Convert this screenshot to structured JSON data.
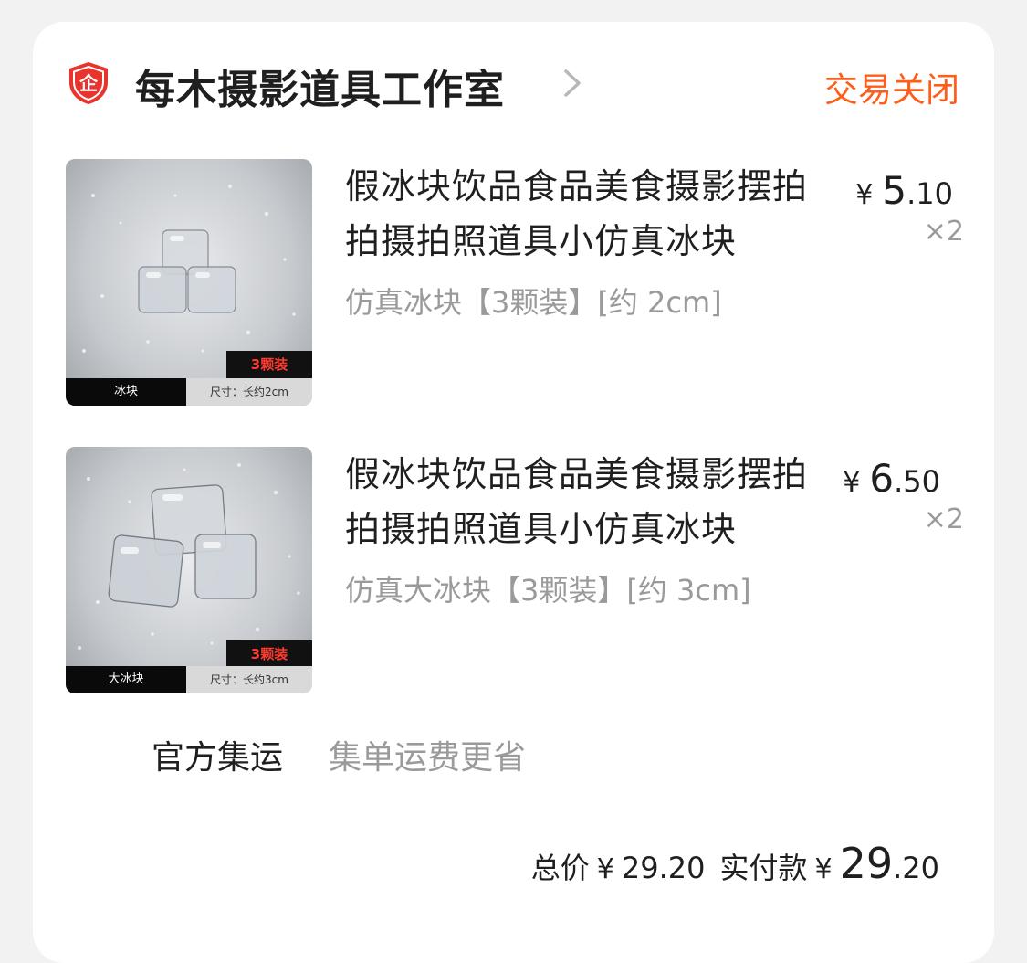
{
  "shop": {
    "name": "每木摄影道具工作室",
    "badge_text": "企",
    "status": "交易关闭"
  },
  "items": [
    {
      "title": "假冰块饮品食品美食摄影摆拍拍摄拍照道具小仿真冰块",
      "spec": "仿真冰块【3颗装】[约 2cm]",
      "price_symbol": "¥",
      "price_int": "5",
      "price_dec": ".10",
      "qty": "×2",
      "thumb_tag": "3颗装",
      "thumb_label_left": "冰块",
      "thumb_label_right": "尺寸：长约2cm"
    },
    {
      "title": "假冰块饮品食品美食摄影摆拍拍摄拍照道具小仿真冰块",
      "spec": "仿真大冰块【3颗装】[约 3cm]",
      "price_symbol": "¥",
      "price_int": "6",
      "price_dec": ".50",
      "qty": "×2",
      "thumb_tag": "3颗装",
      "thumb_label_left": "大冰块",
      "thumb_label_right": "尺寸：长约3cm"
    }
  ],
  "shipping": {
    "title": "官方集运",
    "desc": "集单运费更省"
  },
  "totals": {
    "total_label": "总价",
    "total_symbol": "¥",
    "total_value": "29.20",
    "paid_label": "实付款",
    "paid_symbol": "¥",
    "paid_int": "29",
    "paid_dec": ".20"
  },
  "colors": {
    "status": "#ff5e1a",
    "badge": "#e8342c",
    "muted": "#9a9a9a"
  },
  "icons": {
    "badge": "enterprise-shield-icon",
    "chevron": "chevron-right-icon"
  }
}
